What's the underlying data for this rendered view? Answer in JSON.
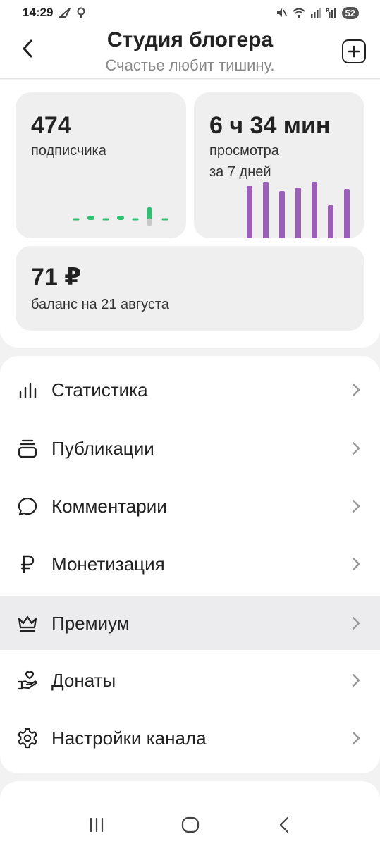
{
  "status_bar": {
    "time": "14:29",
    "battery": "52"
  },
  "header": {
    "title": "Студия блогера",
    "subtitle": "Счастье любит тишину."
  },
  "stats": {
    "subscribers": {
      "value": "474",
      "label": "подписчика"
    },
    "views": {
      "value": "6 ч 34 мин",
      "label_line1": "просмотра",
      "label_line2": "за 7 дней"
    },
    "balance": {
      "value": "71 ₽",
      "label": "баланс на 21 августа"
    }
  },
  "accent_colors": {
    "views_bars": "#9b5fb8",
    "subs_spark": "#2fbf71"
  },
  "menu": {
    "items": [
      {
        "label": "Статистика",
        "icon": "bar-chart-icon"
      },
      {
        "label": "Публикации",
        "icon": "stack-icon"
      },
      {
        "label": "Комментарии",
        "icon": "comment-icon"
      },
      {
        "label": "Монетизация",
        "icon": "ruble-icon"
      },
      {
        "label": "Премиум",
        "icon": "crown-icon"
      },
      {
        "label": "Донаты",
        "icon": "donate-hand-icon"
      },
      {
        "label": "Настройки канала",
        "icon": "gear-icon"
      }
    ]
  }
}
